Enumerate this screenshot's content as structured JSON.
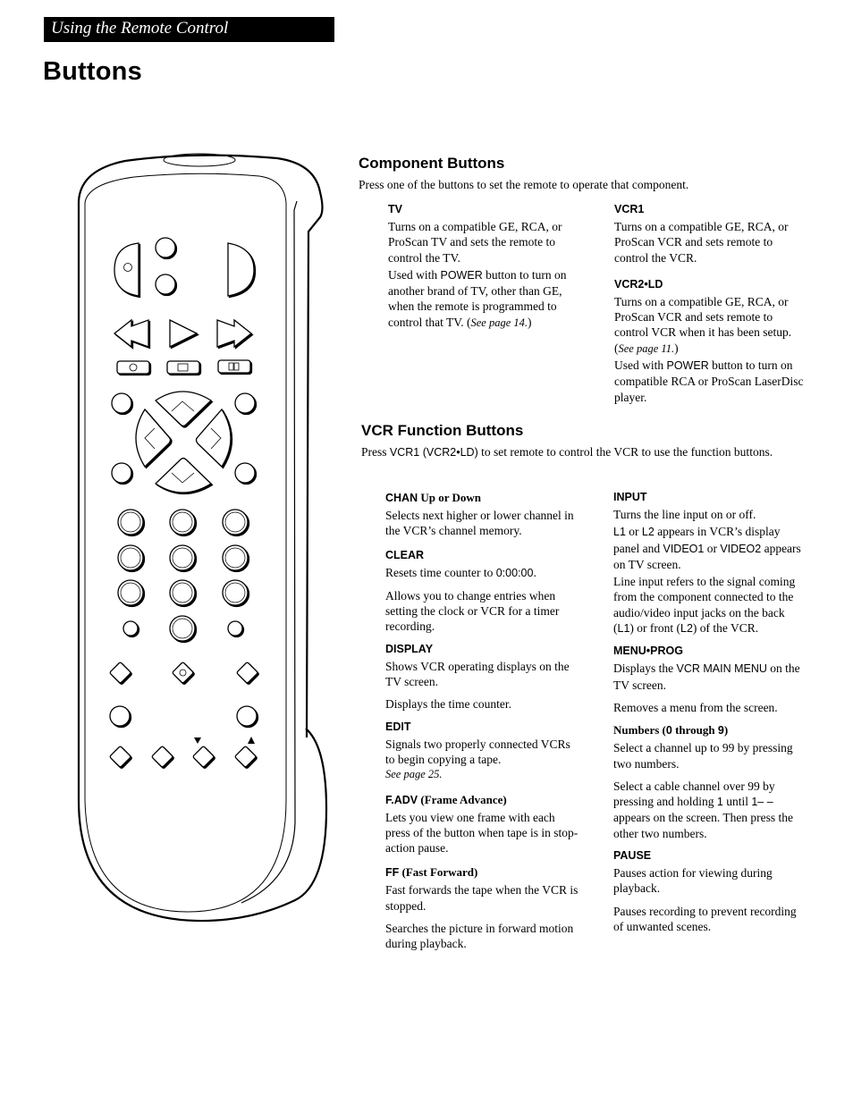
{
  "header": {
    "section": "Using the Remote Control",
    "title": "Buttons"
  },
  "component_buttons": {
    "title": "Component Buttons",
    "intro": "Press one of the buttons to set the remote to operate that component.",
    "entries": [
      {
        "label": "TV",
        "p1": "Turns on a compatible GE, RCA, or ProScan TV and sets the remote to control the TV.",
        "p2_a": "Used with ",
        "p2_b": "POWER",
        "p2_c": " button to turn on another brand of TV, other than GE, when the remote is programmed to control that TV.  (",
        "p2_ref": "See page 14.",
        "p2_d": ")"
      },
      {
        "label": "VCR1",
        "p1": "Turns on a compatible GE, RCA, or ProScan VCR and sets remote to control the VCR."
      },
      {
        "label": "VCR2•LD",
        "p1_a": "Turns on a compatible GE, RCA, or ProScan VCR and sets remote to control VCR when it has been setup.  (",
        "p1_ref": "See page 11.",
        "p1_b": ")",
        "p2_a": "Used with ",
        "p2_b": "POWER",
        "p2_c": " button to turn on compatible RCA or ProScan LaserDisc player."
      }
    ]
  },
  "vcr_function_buttons": {
    "title": "VCR Function Buttons",
    "intro_a": "Press ",
    "intro_b": "VCR1 (VCR2•LD)",
    "intro_c": " to set remote to control the VCR to use the function buttons.",
    "left": [
      {
        "label": "CHAN",
        "label_sub": " Up or Down",
        "p1": "Selects next higher or lower channel in the VCR’s channel memory."
      },
      {
        "label": "CLEAR",
        "p1_a": "Resets time counter to ",
        "p1_b": "0:00:00",
        "p1_c": ".",
        "p2": "Allows you to change entries when setting the clock or VCR for a timer recording."
      },
      {
        "label": "DISPLAY",
        "p1": "Shows VCR operating displays on the TV screen.",
        "p2": "Displays the time counter."
      },
      {
        "label": "EDIT",
        "p1": "Signals two properly connected VCRs to begin copying a tape.",
        "ref": "See page 25."
      },
      {
        "label": "F.ADV",
        "label_sub": " (Frame Advance)",
        "p1": "Lets you view one frame with each press of the button when tape is in stop-action pause."
      },
      {
        "label": "FF",
        "label_sub": " (Fast Forward)",
        "p1": "Fast forwards the tape when the VCR is stopped.",
        "p2": "Searches the picture in forward motion during playback."
      }
    ],
    "right": [
      {
        "label": "INPUT",
        "p1": "Turns the line input on or off.",
        "p2_a": "L1",
        "p2_b": " or ",
        "p2_c": "L2",
        "p2_d": " appears in VCR’s display panel and ",
        "p2_e": "VIDEO1",
        "p2_f": " or ",
        "p2_g": "VIDEO2",
        "p2_h": " appears on TV screen.",
        "p3_a": "Line input refers to the signal coming from the component connected to the audio/video input jacks on the back (",
        "p3_b": "L1",
        "p3_c": ") or front (",
        "p3_d": "L2",
        "p3_e": ") of the VCR."
      },
      {
        "label": "MENU•PROG",
        "p1_a": "Displays the ",
        "p1_b": "VCR MAIN MENU",
        "p1_c": " on the TV screen.",
        "p2": "Removes a menu from the screen."
      },
      {
        "label_a": "Numbers (",
        "label_b": "0",
        "label_c": " through ",
        "label_d": "9",
        "label_e": ")",
        "p1": "Select a channel up to 99 by pressing two numbers.",
        "p2_a": "Select a cable channel over 99 by pressing and holding ",
        "p2_b": "1",
        "p2_c": " until ",
        "p2_d": "1– –",
        "p2_e": " appears on the screen.  Then press the other two numbers."
      },
      {
        "label": "PAUSE",
        "p1": "Pauses action for viewing during playback.",
        "p2": "Pauses recording to prevent recording of unwanted scenes."
      }
    ]
  },
  "remote_illustration": {
    "icons": [
      "tv-button-icon",
      "vcr1-button-icon",
      "vcr2ld-button-icon",
      "power-button-icon",
      "rewind-icon",
      "play-icon",
      "fast-forward-icon",
      "record-icon",
      "stop-icon",
      "pause-icon",
      "directional-pad-icon",
      "number-keypad-icon",
      "channel-down-icon",
      "channel-up-icon"
    ]
  }
}
